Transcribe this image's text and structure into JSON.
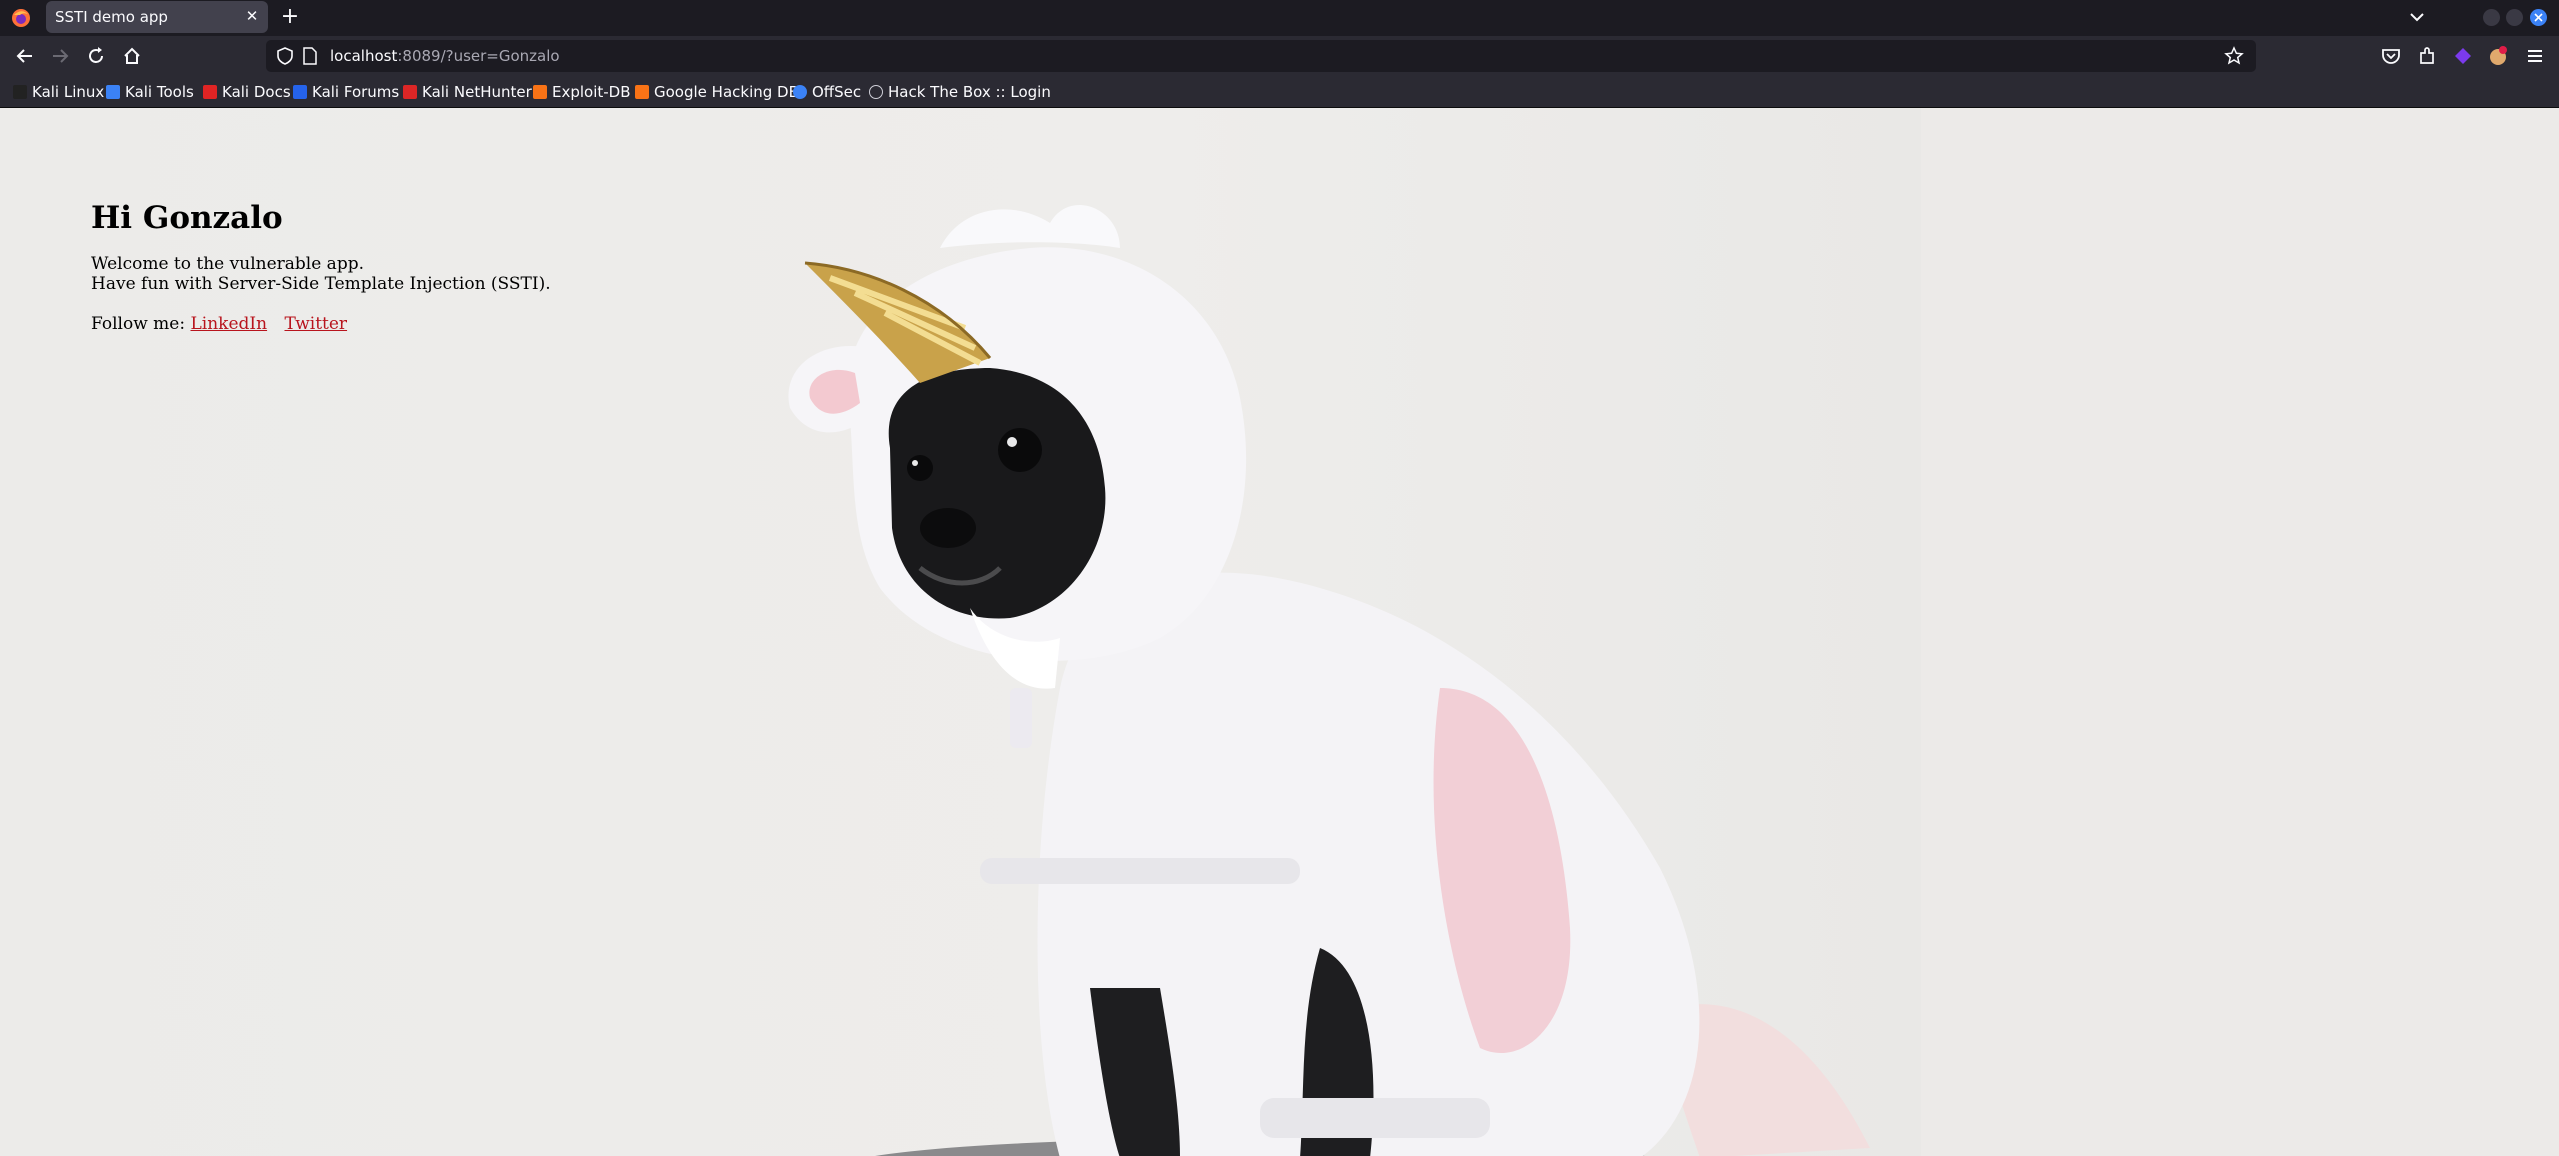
{
  "browser": {
    "tab_title": "SSTI demo app",
    "url_host": "localhost",
    "url_rest": ":8089/?user=Gonzalo",
    "bookmarks": [
      {
        "label": "Kali Linux",
        "color": "#222222"
      },
      {
        "label": "Kali Tools",
        "color": "#3b82f6"
      },
      {
        "label": "Kali Docs",
        "color": "#e02424"
      },
      {
        "label": "Kali Forums",
        "color": "#2563eb"
      },
      {
        "label": "Kali NetHunter",
        "color": "#dc2626"
      },
      {
        "label": "Exploit-DB",
        "color": "#f97316"
      },
      {
        "label": "Google Hacking DB",
        "color": "#f97316"
      },
      {
        "label": "OffSec",
        "color": "#3b82f6"
      },
      {
        "label": "Hack The Box :: Login",
        "color": "#cfcfd8"
      }
    ]
  },
  "page": {
    "heading": "Hi Gonzalo",
    "line1": "Welcome to the vulnerable app.",
    "line2": "Have fun with Server-Side Template Injection (SSTI).",
    "follow_label": "Follow me:",
    "link_linkedin": "LinkedIn",
    "link_twitter": "Twitter"
  }
}
